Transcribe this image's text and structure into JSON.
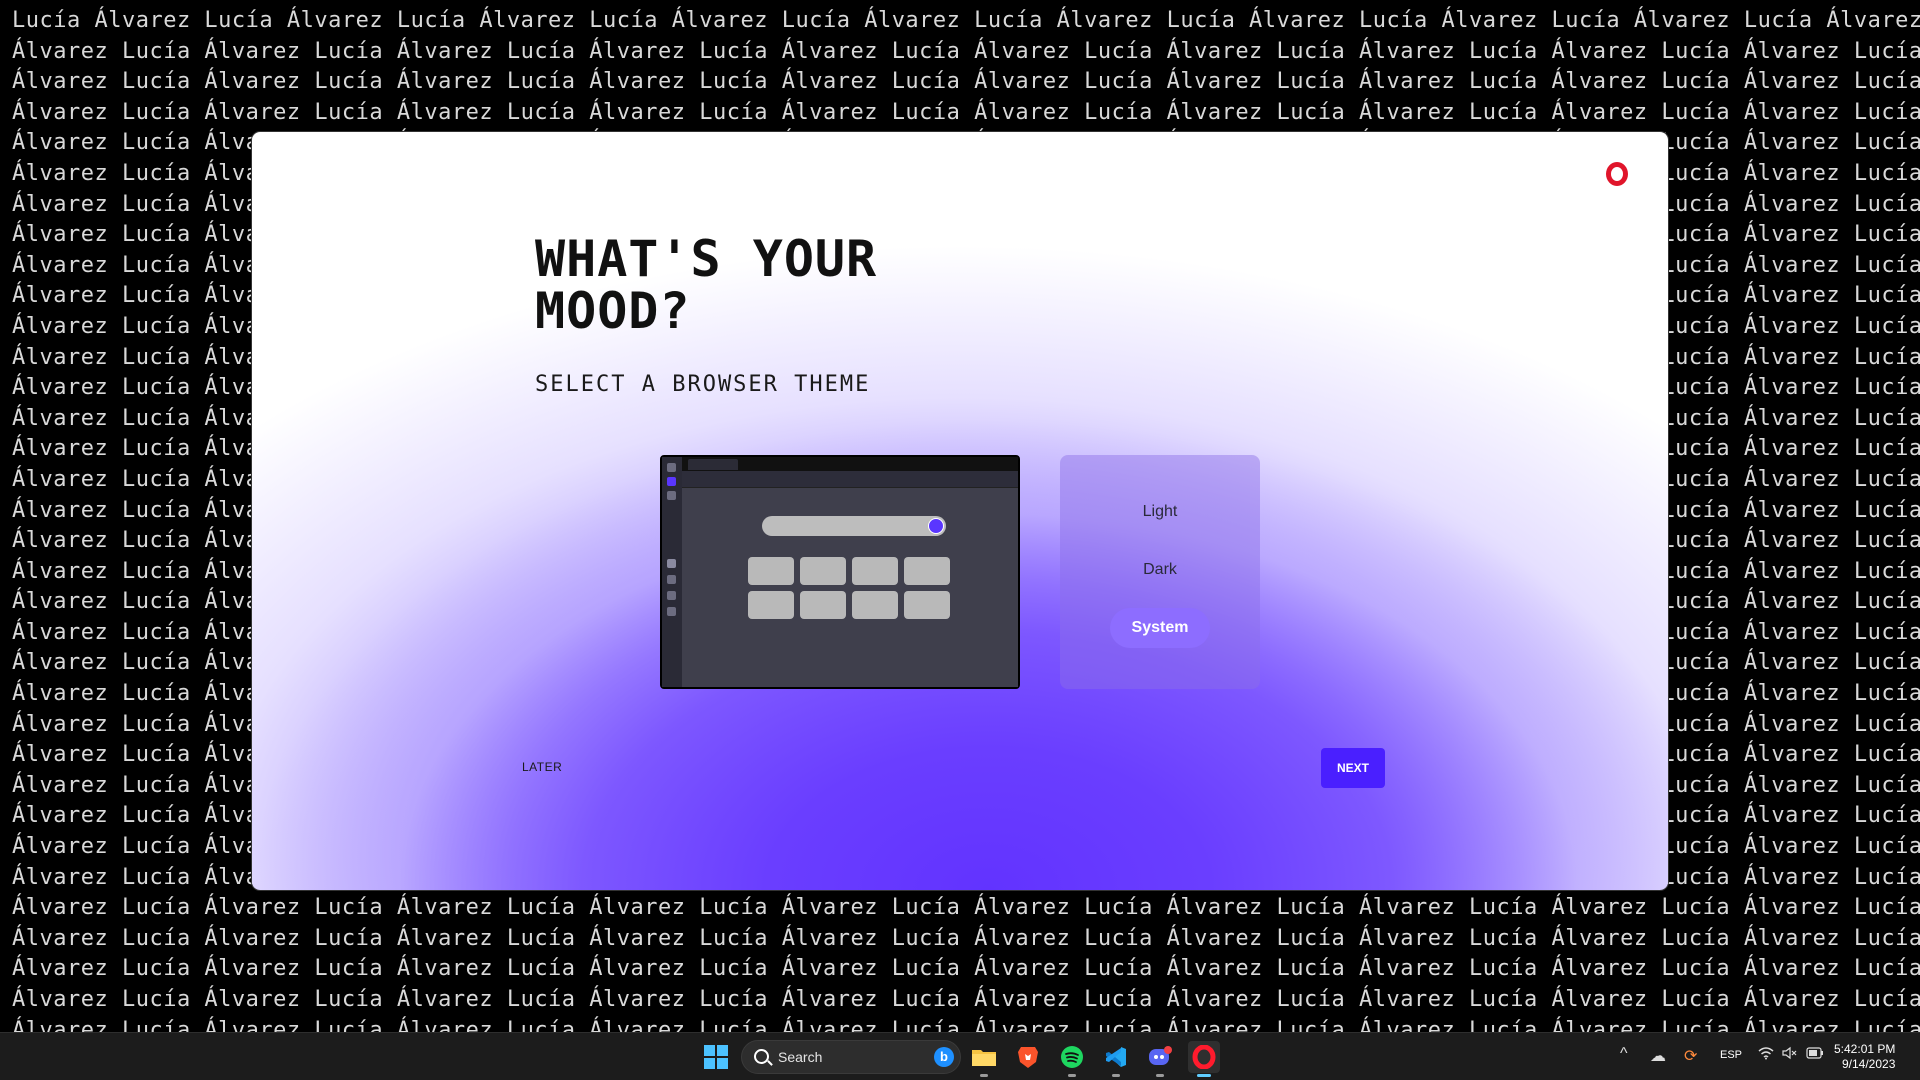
{
  "wallpaper": {
    "line_a": "Lucía Álvarez Lucía Álvarez Lucía Álvarez Lucía Álvarez Lucía Álvarez Lucía Álvarez Lucía Álvarez Lucía Álvarez Lucía Álvarez Lucía Álvarez",
    "line_b": "Álvarez Lucía Álvarez Lucía Álvarez Lucía Álvarez Lucía Álvarez Lucía Álvarez Lucía Álvarez Lucía Álvarez Lucía Álvarez Lucía Álvarez Lucía"
  },
  "onboarding": {
    "title": "WHAT'S YOUR MOOD?",
    "subtitle": "SELECT A BROWSER THEME",
    "theme_options": [
      "Light",
      "Dark",
      "System"
    ],
    "selected_theme": "System",
    "later_label": "LATER",
    "next_label": "NEXT"
  },
  "taskbar": {
    "search_placeholder": "Search",
    "apps": [
      "file-explorer",
      "brave",
      "spotify",
      "vscode",
      "discord",
      "opera"
    ],
    "language": "ESP",
    "time": "5:42:01 PM",
    "date": "9/14/2023"
  },
  "colors": {
    "accent": "#4a1fff",
    "opera_red": "#e0152b",
    "gradient_core": "#6233ff"
  }
}
